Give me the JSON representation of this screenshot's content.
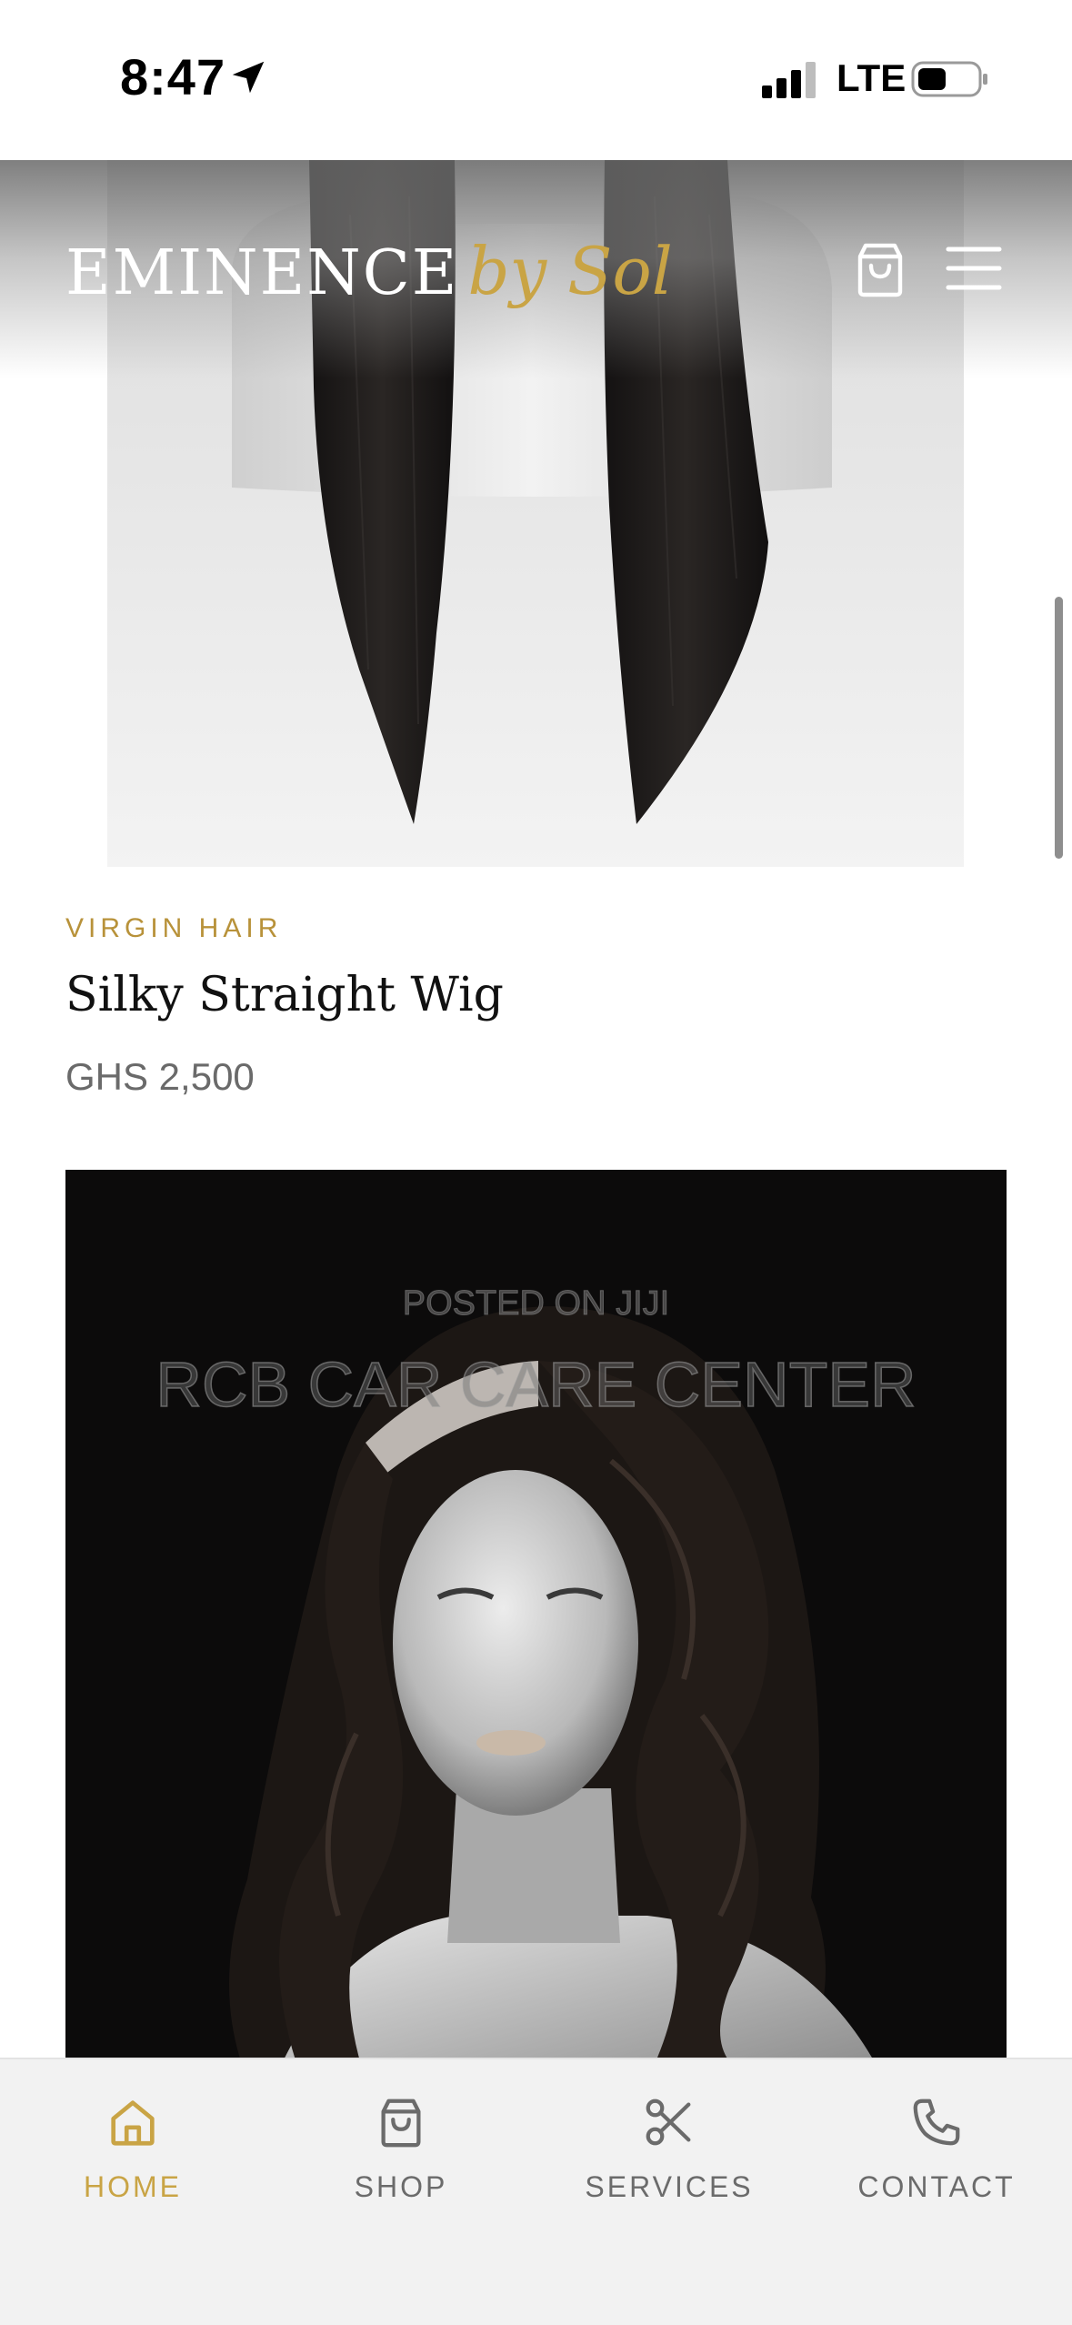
{
  "status_bar": {
    "time": "8:47",
    "network": "LTE",
    "icons": [
      "location-arrow-icon",
      "signal-bars-icon",
      "battery-icon"
    ]
  },
  "header": {
    "logo_main": "EMINENCE",
    "logo_accent": "by Sol",
    "icons": [
      "shopping-bag-icon",
      "hamburger-menu-icon"
    ]
  },
  "products": [
    {
      "category": "VIRGIN HAIR",
      "name": "Silky Straight Wig",
      "price": "GHS 2,500"
    },
    {
      "watermark_top": "POSTED ON JIJI",
      "watermark_main": "RCB CAR CARE CENTER"
    }
  ],
  "bottom_nav": {
    "items": [
      {
        "label": "HOME",
        "icon": "home-icon",
        "active": true
      },
      {
        "label": "SHOP",
        "icon": "shopping-bag-icon",
        "active": false
      },
      {
        "label": "SERVICES",
        "icon": "scissors-icon",
        "active": false
      },
      {
        "label": "CONTACT",
        "icon": "phone-icon",
        "active": false
      }
    ]
  },
  "colors": {
    "accent_gold": "#c9a445",
    "category_gold": "#b8923a",
    "nav_inactive": "#6b6b6b",
    "nav_background": "#f2f2f2"
  }
}
